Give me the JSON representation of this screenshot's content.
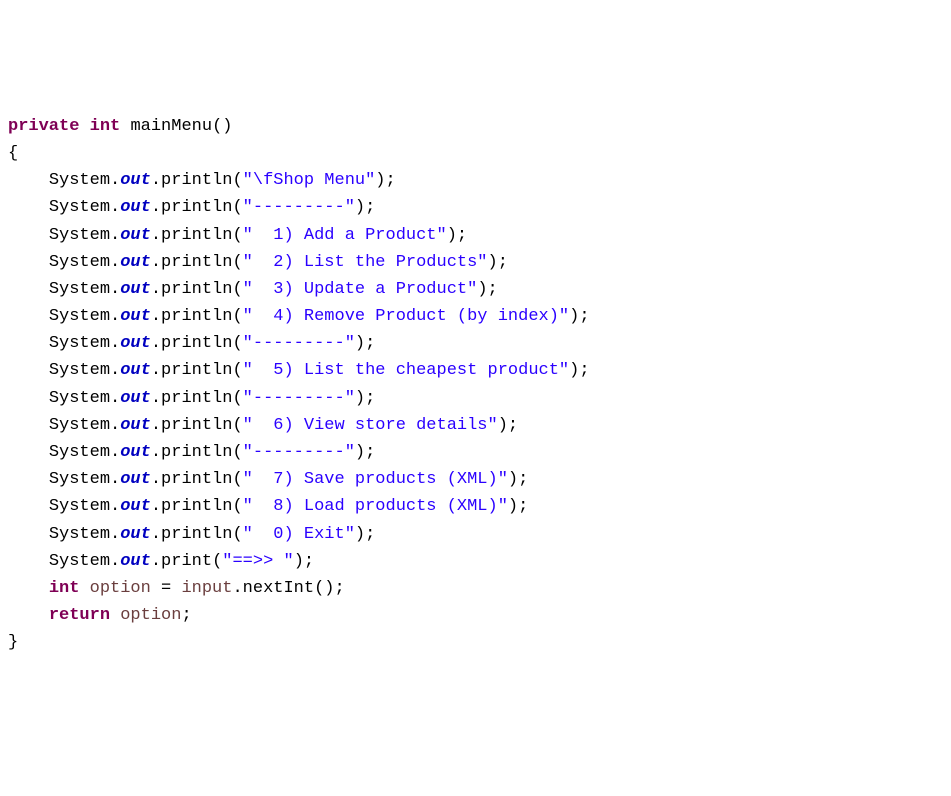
{
  "code": {
    "kw_private": "private",
    "kw_int": "int",
    "kw_return": "return",
    "method_name": "mainMenu",
    "cls_System": "System",
    "field_out": "out",
    "m_println": "println",
    "m_print": "print",
    "m_nextInt": "nextInt",
    "var_option": "option",
    "var_input": "input",
    "open_brace": "{",
    "close_brace": "}",
    "parens": "()",
    "open_paren": "(",
    "close_paren": ")",
    "dot": ".",
    "semi": ";",
    "eq": "=",
    "strings": {
      "s1": "\"\\fShop Menu\"",
      "s2": "\"---------\"",
      "s3": "\"  1) Add a Product\"",
      "s4": "\"  2) List the Products\"",
      "s5": "\"  3) Update a Product\"",
      "s6": "\"  4) Remove Product (by index)\"",
      "s7": "\"---------\"",
      "s8": "\"  5) List the cheapest product\"",
      "s9": "\"---------\"",
      "s10": "\"  6) View store details\"",
      "s11": "\"---------\"",
      "s12": "\"  7) Save products (XML)\"",
      "s13": "\"  8) Load products (XML)\"",
      "s14": "\"  0) Exit\"",
      "s15": "\"==>> \""
    }
  }
}
